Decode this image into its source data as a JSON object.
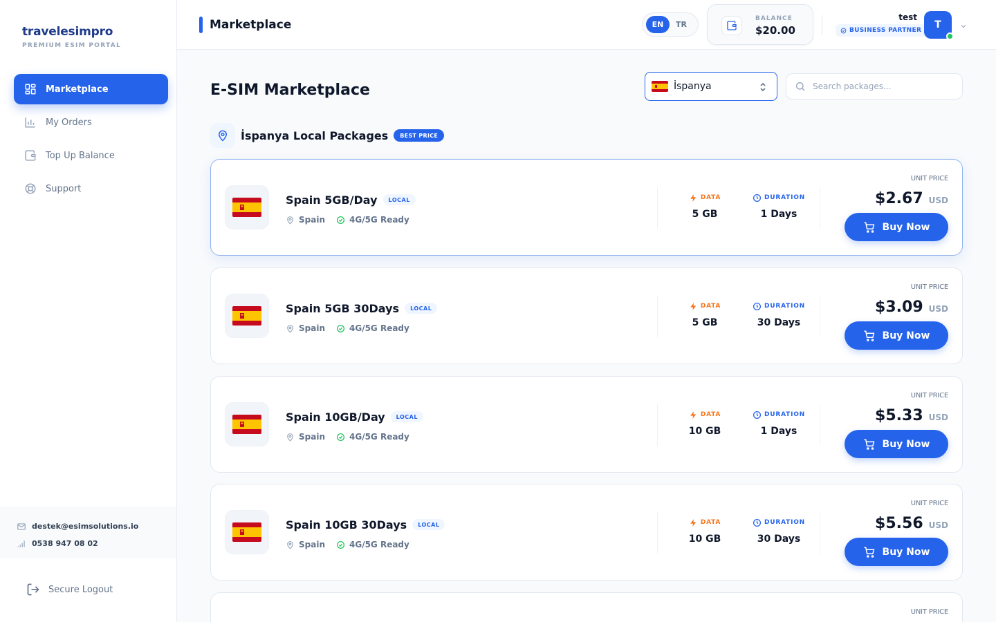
{
  "brand": {
    "name": "travelesimpro",
    "subtitle": "PREMIUM ESIM PORTAL"
  },
  "sidebar": {
    "items": [
      {
        "label": "Marketplace",
        "icon": "grid-icon",
        "active": true
      },
      {
        "label": "My Orders",
        "icon": "bar-chart-icon",
        "active": false
      },
      {
        "label": "Top Up Balance",
        "icon": "wallet-icon",
        "active": false
      },
      {
        "label": "Support",
        "icon": "lifebuoy-icon",
        "active": false
      }
    ],
    "contact": {
      "email": "destek@esimsolutions.io",
      "phone": "0538 947 08 02"
    },
    "logout_label": "Secure Logout"
  },
  "header": {
    "title": "Marketplace",
    "languages": [
      "EN",
      "TR"
    ],
    "active_language": "EN",
    "balance_label": "BALANCE",
    "balance_value": "$20.00",
    "user_name": "test",
    "user_role": "BUSINESS PARTNER",
    "avatar_letter": "T"
  },
  "main": {
    "title": "E-SIM Marketplace",
    "country_select": "İspanya",
    "search_placeholder": "Search packages...",
    "section_title": "İspanya Local Packages",
    "best_badge": "BEST PRICE"
  },
  "labels": {
    "local": "LOCAL",
    "data": "DATA",
    "duration": "DURATION",
    "unit_price": "UNIT PRICE",
    "buy_now": "Buy Now",
    "currency": "USD",
    "network": "4G/5G Ready"
  },
  "packages": [
    {
      "name": "Spain 5GB/Day",
      "country": "Spain",
      "data": "5 GB",
      "duration": "1 Days",
      "price": "$2.67"
    },
    {
      "name": "Spain 5GB 30Days",
      "country": "Spain",
      "data": "5 GB",
      "duration": "30 Days",
      "price": "$3.09"
    },
    {
      "name": "Spain 10GB/Day",
      "country": "Spain",
      "data": "10 GB",
      "duration": "1 Days",
      "price": "$5.33"
    },
    {
      "name": "Spain 10GB 30Days",
      "country": "Spain",
      "data": "10 GB",
      "duration": "30 Days",
      "price": "$5.56"
    }
  ],
  "colors": {
    "primary": "#2563eb",
    "accent_orange": "#f97316",
    "success": "#22c55e",
    "flag_red": "#c60b1e",
    "flag_yellow": "#ffc400"
  }
}
